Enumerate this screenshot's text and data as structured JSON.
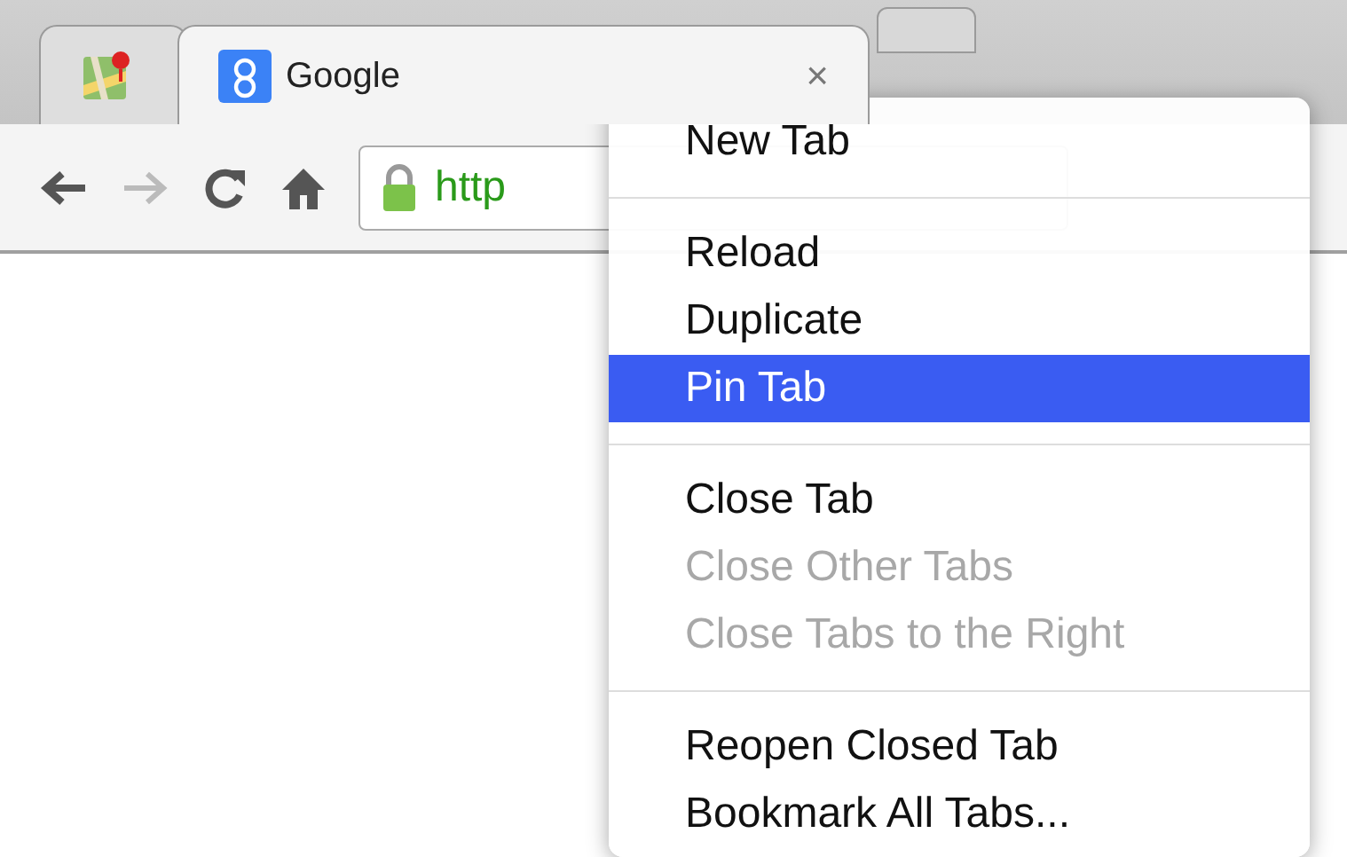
{
  "tabs": [
    {
      "selected": false
    },
    {
      "title": "Google",
      "close": "×",
      "selected": true
    }
  ],
  "toolbar": {
    "url": "http"
  },
  "menu": [
    {
      "kind": "item",
      "label": "New Tab",
      "disabled": false,
      "selected": false
    },
    {
      "kind": "separator"
    },
    {
      "kind": "item",
      "label": "Reload",
      "disabled": false,
      "selected": false
    },
    {
      "kind": "item",
      "label": "Duplicate",
      "disabled": false,
      "selected": false
    },
    {
      "kind": "item",
      "label": "Pin Tab",
      "disabled": false,
      "selected": true
    },
    {
      "kind": "separator"
    },
    {
      "kind": "item",
      "label": "Close Tab",
      "disabled": false,
      "selected": false
    },
    {
      "kind": "item",
      "label": "Close Other Tabs",
      "disabled": true,
      "selected": false
    },
    {
      "kind": "item",
      "label": "Close Tabs to the Right",
      "disabled": true,
      "selected": false
    },
    {
      "kind": "separator"
    },
    {
      "kind": "item",
      "label": "Reopen Closed Tab",
      "disabled": false,
      "selected": false
    },
    {
      "kind": "item",
      "label": "Bookmark All Tabs...",
      "disabled": false,
      "selected": false
    }
  ]
}
